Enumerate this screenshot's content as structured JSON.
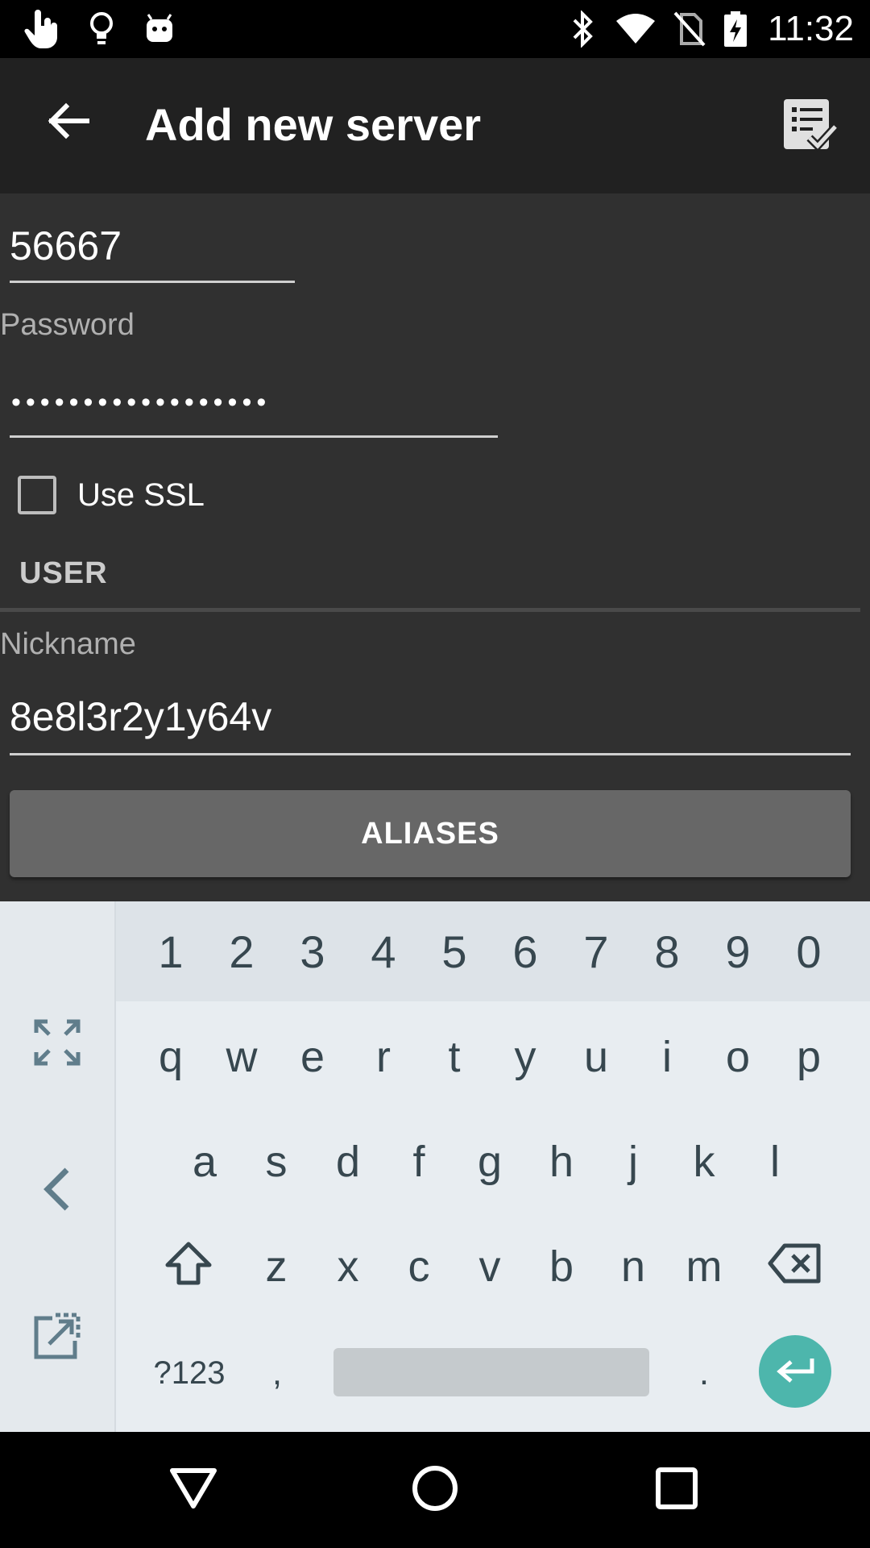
{
  "status_bar": {
    "time": "11:32",
    "left_icons": [
      "touch-gesture-icon",
      "lightbulb-icon",
      "android-icon"
    ],
    "right_icons": [
      "bluetooth-icon",
      "wifi-icon",
      "no-sim-icon",
      "battery-charging-icon"
    ]
  },
  "app_bar": {
    "title": "Add new server",
    "back_icon": "arrow-back-icon",
    "save_icon": "checklist-save-icon"
  },
  "form": {
    "port_value": "56667",
    "password_label": "Password",
    "password_value": "••••••••••••••••••",
    "use_ssl_label": "Use SSL",
    "use_ssl_checked": false,
    "user_section_title": "USER",
    "nickname_label": "Nickname",
    "nickname_value": "8e8l3r2y1y64v",
    "aliases_button": "ALIASES"
  },
  "keyboard": {
    "numbers": [
      "1",
      "2",
      "3",
      "4",
      "5",
      "6",
      "7",
      "8",
      "9",
      "0"
    ],
    "row1": [
      "q",
      "w",
      "e",
      "r",
      "t",
      "y",
      "u",
      "i",
      "o",
      "p"
    ],
    "row2": [
      "a",
      "s",
      "d",
      "f",
      "g",
      "h",
      "j",
      "k",
      "l"
    ],
    "row3": [
      "z",
      "x",
      "c",
      "v",
      "b",
      "n",
      "m"
    ],
    "symbols_key": "?123",
    "comma_key": ",",
    "period_key": ".",
    "accent_color": "#4db6ac"
  },
  "nav_bar": {
    "icons": [
      "back-triangle-icon",
      "home-circle-icon",
      "recents-square-icon"
    ]
  }
}
